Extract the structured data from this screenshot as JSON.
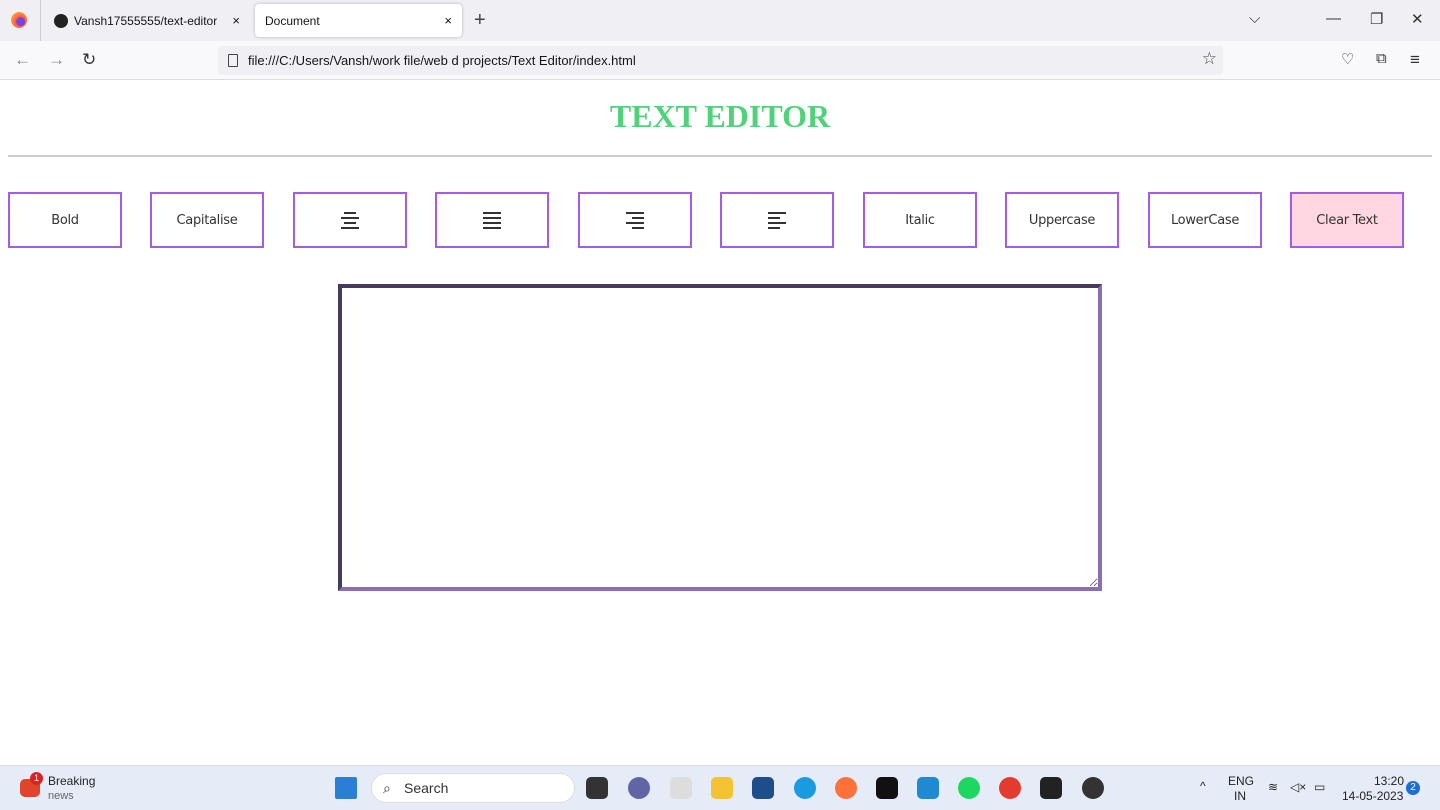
{
  "browser": {
    "tabs": [
      {
        "label": "Vansh17555555/text-editor",
        "close": "×"
      },
      {
        "label": "Document",
        "close": "×"
      }
    ],
    "new_tab": "+",
    "url": "file:///C:/Users/Vansh/work file/web d projects/Text Editor/index.html",
    "window_controls": {
      "list": "⌵",
      "minimize": "—",
      "restore": "❐",
      "close": "✕"
    },
    "nav": {
      "back": "←",
      "forward": "→",
      "reload": "↻"
    },
    "icons": {
      "bookmark": "☆",
      "pocket": "♡",
      "extensions": "⧉",
      "menu": "≡"
    }
  },
  "page": {
    "title": "TEXT EDITOR",
    "buttons": [
      {
        "label": "Bold"
      },
      {
        "label": "Capitalise"
      },
      {
        "label": "",
        "icon": "align-center-icon"
      },
      {
        "label": "",
        "icon": "align-justify-icon"
      },
      {
        "label": "",
        "icon": "align-right-icon"
      },
      {
        "label": "",
        "icon": "align-left-icon"
      },
      {
        "label": "Italic"
      },
      {
        "label": "Uppercase"
      },
      {
        "label": "LowerCase"
      },
      {
        "label": "Clear Text"
      }
    ],
    "textarea_value": "",
    "accent": "#a35ce8",
    "title_color": "#4fd37a",
    "clear_bg": "#ffd7e2"
  },
  "taskbar": {
    "news_title": "Breaking",
    "news_sub": "news",
    "news_badge": "1",
    "search": "Search",
    "lang": "ENG",
    "region": "IN",
    "time": "13:20",
    "date": "14-05-2023",
    "notif": "2"
  }
}
